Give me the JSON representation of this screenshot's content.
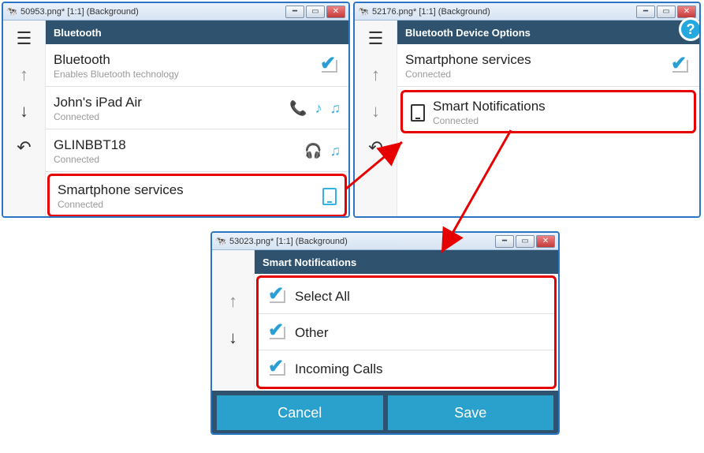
{
  "windows": {
    "left": {
      "title": "50953.png* [1:1] (Background)",
      "panel_header": "Bluetooth",
      "rows": {
        "bluetooth": {
          "title": "Bluetooth",
          "sub": "Enables Bluetooth technology"
        },
        "ipad": {
          "title": "John's iPad Air",
          "sub": "Connected"
        },
        "glin": {
          "title": "GLINBBT18",
          "sub": "Connected"
        },
        "smartphone": {
          "title": "Smartphone services",
          "sub": "Connected"
        }
      }
    },
    "right": {
      "title": "52176.png* [1:1] (Background)",
      "panel_header": "Bluetooth Device Options",
      "rows": {
        "smartphone": {
          "title": "Smartphone services",
          "sub": "Connected"
        },
        "notif": {
          "title": "Smart Notifications",
          "sub": "Connected"
        }
      }
    },
    "bottom": {
      "title": "53023.png* [1:1] (Background)",
      "panel_header": "Smart Notifications",
      "rows": {
        "selectall": {
          "title": "Select All"
        },
        "other": {
          "title": "Other"
        },
        "incoming": {
          "title": "Incoming Calls"
        }
      },
      "buttons": {
        "cancel": "Cancel",
        "save": "Save"
      }
    }
  }
}
